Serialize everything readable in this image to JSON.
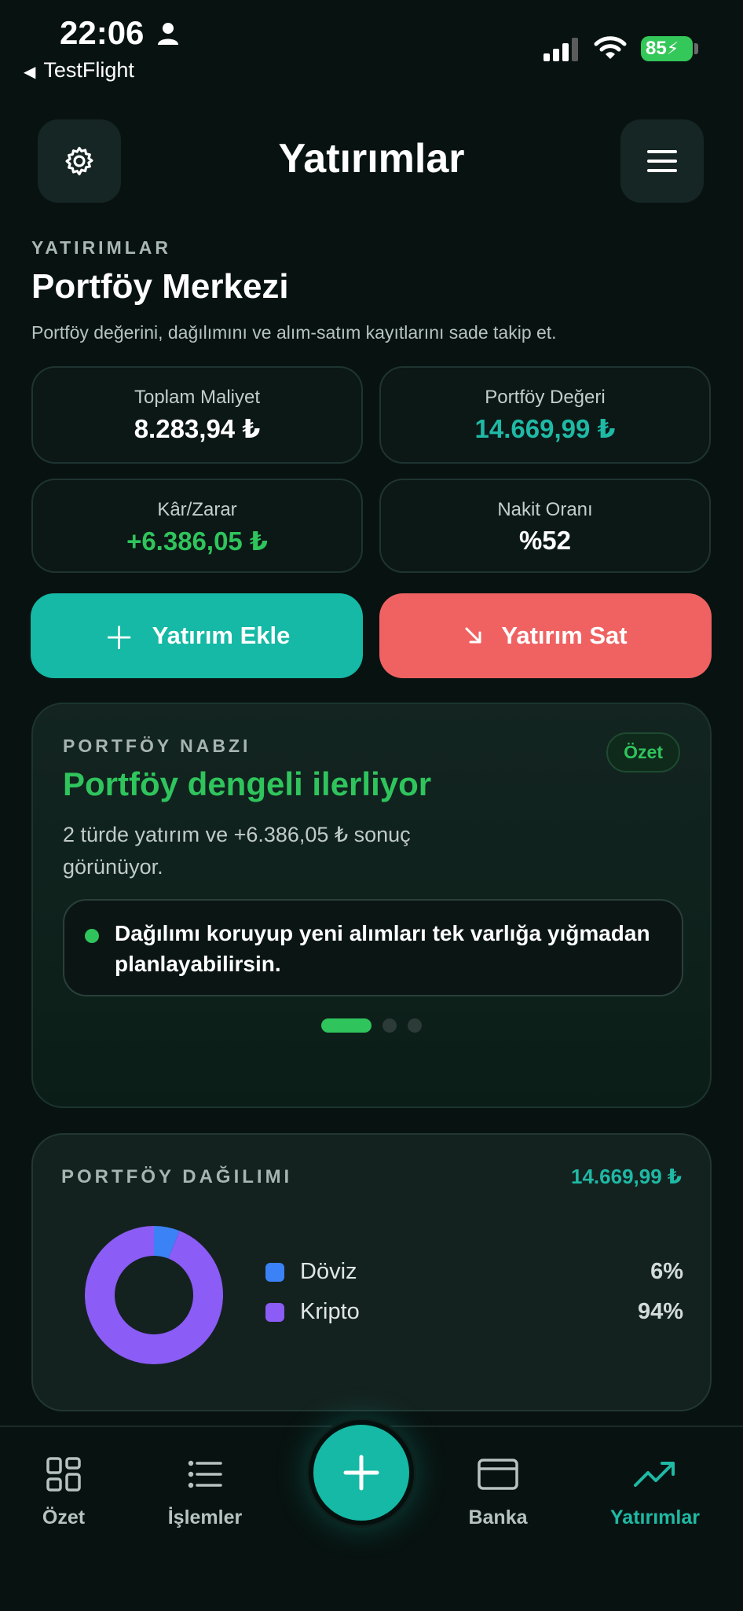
{
  "status_bar": {
    "time": "22:06",
    "back_label": "TestFlight",
    "battery": "85"
  },
  "header": {
    "title": "Yatırımlar"
  },
  "intro": {
    "kicker": "YATIRIMLAR",
    "heading": "Portföy Merkezi",
    "description": "Portföy değerini, dağılımını ve alım-satım kayıtlarını sade takip et."
  },
  "stats": [
    {
      "label": "Toplam Maliyet",
      "value": "8.283,94 ₺"
    },
    {
      "label": "Portföy Değeri",
      "value": "14.669,99 ₺"
    },
    {
      "label": "Kâr/Zarar",
      "value": "+6.386,05 ₺"
    },
    {
      "label": "Nakit Oranı",
      "value": "%52"
    }
  ],
  "actions": {
    "add_label": "Yatırım Ekle",
    "sell_label": "Yatırım Sat"
  },
  "pulse": {
    "kicker": "PORTFÖY NABZI",
    "badge": "Özet",
    "title": "Portföy dengeli ilerliyor",
    "description": "2 türde yatırım ve +6.386,05 ₺ sonuç görünüyor.",
    "tip": "Dağılımı koruyup yeni alımları tek varlığa yığmadan planlayabilirsin.",
    "active_slide": 0,
    "slide_count": 3
  },
  "distribution": {
    "kicker": "PORTFÖY DAĞILIMI",
    "total": "14.669,99 ₺",
    "items": [
      {
        "name": "Döviz",
        "percent": "6%",
        "value": 6,
        "color": "#3b82f6"
      },
      {
        "name": "Kripto",
        "percent": "94%",
        "value": 94,
        "color": "#8b5cf6"
      }
    ]
  },
  "nav": {
    "items": [
      {
        "label": "Özet",
        "icon": "grid-icon"
      },
      {
        "label": "İşlemler",
        "icon": "list-icon"
      },
      {
        "label": "Banka",
        "icon": "card-icon"
      },
      {
        "label": "Yatırımlar",
        "icon": "trend-up-icon"
      }
    ],
    "fab_icon": "plus-icon"
  },
  "colors": {
    "accent_teal": "#15b9a5",
    "positive_green": "#2fc45c",
    "sell_red": "#f06262",
    "background": "#081311"
  }
}
